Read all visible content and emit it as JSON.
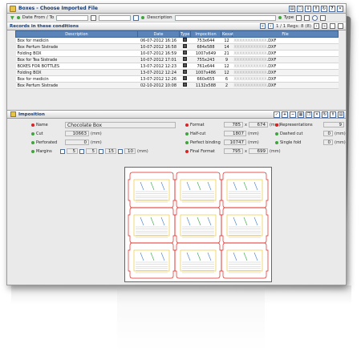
{
  "window": {
    "title": "Boxes - Choose Imported File"
  },
  "filter": {
    "date_label": "Date From / To",
    "description_label": "Description",
    "type_label": "Type"
  },
  "records": {
    "title": "Records in these conditions",
    "pagination": "1 / 1  Regs: 8  (8)",
    "columns": [
      "Description",
      "Date",
      "Type",
      "Impocition",
      "Kexat",
      "File"
    ],
    "rows": [
      {
        "description": "Box for medicin",
        "date": "06-07-2012 16:16",
        "impocition": "753x644",
        "kexat": "12",
        "file_suffix": ".DXF"
      },
      {
        "description": "Box Perfum Sistrade",
        "date": "10-07-2012 16:58",
        "impocition": "684x588",
        "kexat": "14",
        "file_suffix": ".DXF"
      },
      {
        "description": "Folding BOX",
        "date": "10-07-2012 16:59",
        "impocition": "1007x649",
        "kexat": "21",
        "file_suffix": ".DXF"
      },
      {
        "description": "Box for Tea Sistrade",
        "date": "10-07-2012 17:01",
        "impocition": "755x243",
        "kexat": "9",
        "file_suffix": ".DXF"
      },
      {
        "description": "BOXES FOR BOTTLES",
        "date": "13-07-2012 12:23",
        "impocition": "761x644",
        "kexat": "12",
        "file_suffix": ".DXF"
      },
      {
        "description": "Folding BOX",
        "date": "13-07-2012 12:24",
        "impocition": "1007x486",
        "kexat": "12",
        "file_suffix": ".DXF"
      },
      {
        "description": "Box for medicin",
        "date": "13-07-2012 12:26",
        "impocition": "660x655",
        "kexat": "6",
        "file_suffix": ".DXF"
      },
      {
        "description": "Box Perfum Sistrade",
        "date": "02-10-2012 10:08",
        "impocition": "1132x588",
        "kexat": "2",
        "file_suffix": ".DXF"
      }
    ]
  },
  "imposition": {
    "title": "Imposition",
    "name_label": "Name",
    "name_value": "Chocolate Box",
    "cut_label": "Cut",
    "cut_value": "10663",
    "perforated_label": "Perforated",
    "perforated_value": "0",
    "margins_label": "Margins",
    "margin_values": [
      "5",
      "5",
      "15",
      "10"
    ],
    "format_label": "Format",
    "format_w": "785",
    "format_h": "674",
    "halfcut_label": "Half-cut",
    "halfcut_value": "1807",
    "perfect_binding_label": "Perfect binding",
    "perfect_binding_value": "10747",
    "final_format_label": "Final Format",
    "final_w": "795",
    "final_h": "699",
    "representations_label": "Representations",
    "representations_value": "9",
    "dashed_cut_label": "Dashed cut",
    "dashed_cut_value": "0",
    "single_fold_label": "Single fold",
    "single_fold_value": "0",
    "unit_mm": "(mm)",
    "x_sep": "x"
  },
  "colors": {
    "accent": "#123c7a",
    "table_header": "#5b84b8",
    "required_dot": "#dd2222",
    "ok_dot": "#3fa43a"
  }
}
